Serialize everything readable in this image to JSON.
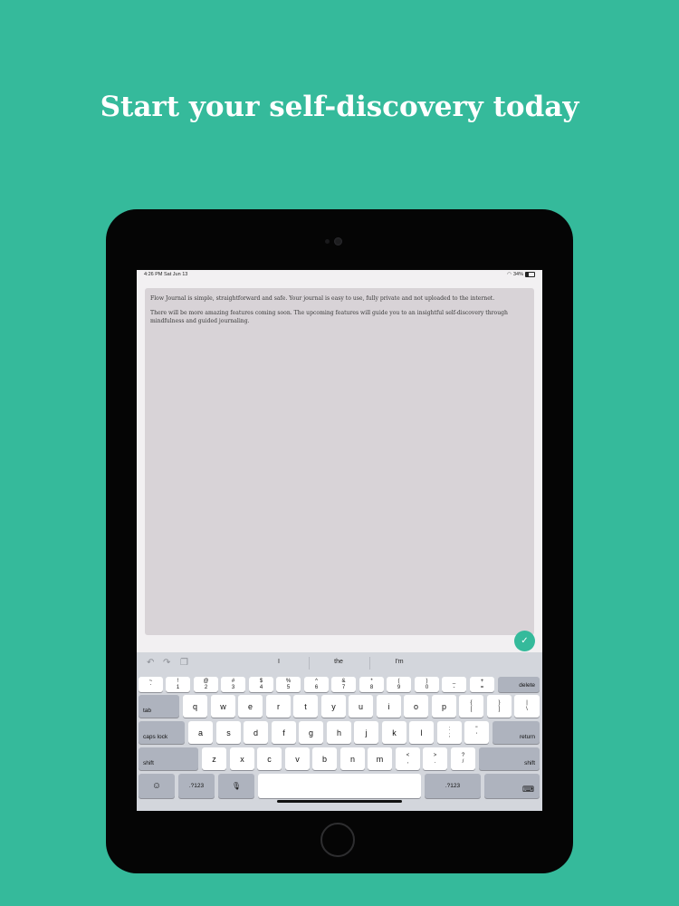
{
  "headline": "Start your self-discovery today",
  "status": {
    "time": "4:26 PM  Sat Jun 13",
    "battery": "34%"
  },
  "editor": {
    "para1": "Flow Journal is simple, straightforward and safe. Your journal is easy to use, fully private and not uploaded to the internet.",
    "para2": "There will be more amazing features coming soon. The upcoming features will guide you to an insightful self-discovery through mindfulness and guided journaling."
  },
  "done_icon": "✓",
  "suggestions": [
    "I",
    "the",
    "I'm"
  ],
  "tool_icons": [
    "undo-icon",
    "redo-icon",
    "paste-icon"
  ],
  "keyboard": {
    "number_row": [
      {
        "top": "~",
        "bottom": "`"
      },
      {
        "top": "!",
        "bottom": "1"
      },
      {
        "top": "@",
        "bottom": "2"
      },
      {
        "top": "#",
        "bottom": "3"
      },
      {
        "top": "$",
        "bottom": "4"
      },
      {
        "top": "%",
        "bottom": "5"
      },
      {
        "top": "^",
        "bottom": "6"
      },
      {
        "top": "&",
        "bottom": "7"
      },
      {
        "top": "*",
        "bottom": "8"
      },
      {
        "top": "(",
        "bottom": "9"
      },
      {
        "top": ")",
        "bottom": "0"
      },
      {
        "top": "_",
        "bottom": "-"
      },
      {
        "top": "+",
        "bottom": "="
      }
    ],
    "delete": "delete",
    "tab": "tab",
    "row_q": [
      "q",
      "w",
      "e",
      "r",
      "t",
      "y",
      "u",
      "i",
      "o",
      "p"
    ],
    "row_q_extra": [
      {
        "top": "{",
        "bottom": "["
      },
      {
        "top": "}",
        "bottom": "]"
      },
      {
        "top": "|",
        "bottom": "\\"
      }
    ],
    "caps": "caps lock",
    "row_a": [
      "a",
      "s",
      "d",
      "f",
      "g",
      "h",
      "j",
      "k",
      "l"
    ],
    "row_a_extra": [
      {
        "top": ":",
        "bottom": ";"
      },
      {
        "top": "\"",
        "bottom": "'"
      }
    ],
    "return": "return",
    "shift": "shift",
    "row_z": [
      "z",
      "x",
      "c",
      "v",
      "b",
      "n",
      "m"
    ],
    "row_z_extra": [
      {
        "top": "<",
        "bottom": ","
      },
      {
        "top": ">",
        "bottom": "."
      },
      {
        "top": "?",
        "bottom": "/"
      }
    ],
    "emoji": "☺",
    "numbers_label": ".?123",
    "mic": "🎙",
    "hide": "⌨"
  }
}
